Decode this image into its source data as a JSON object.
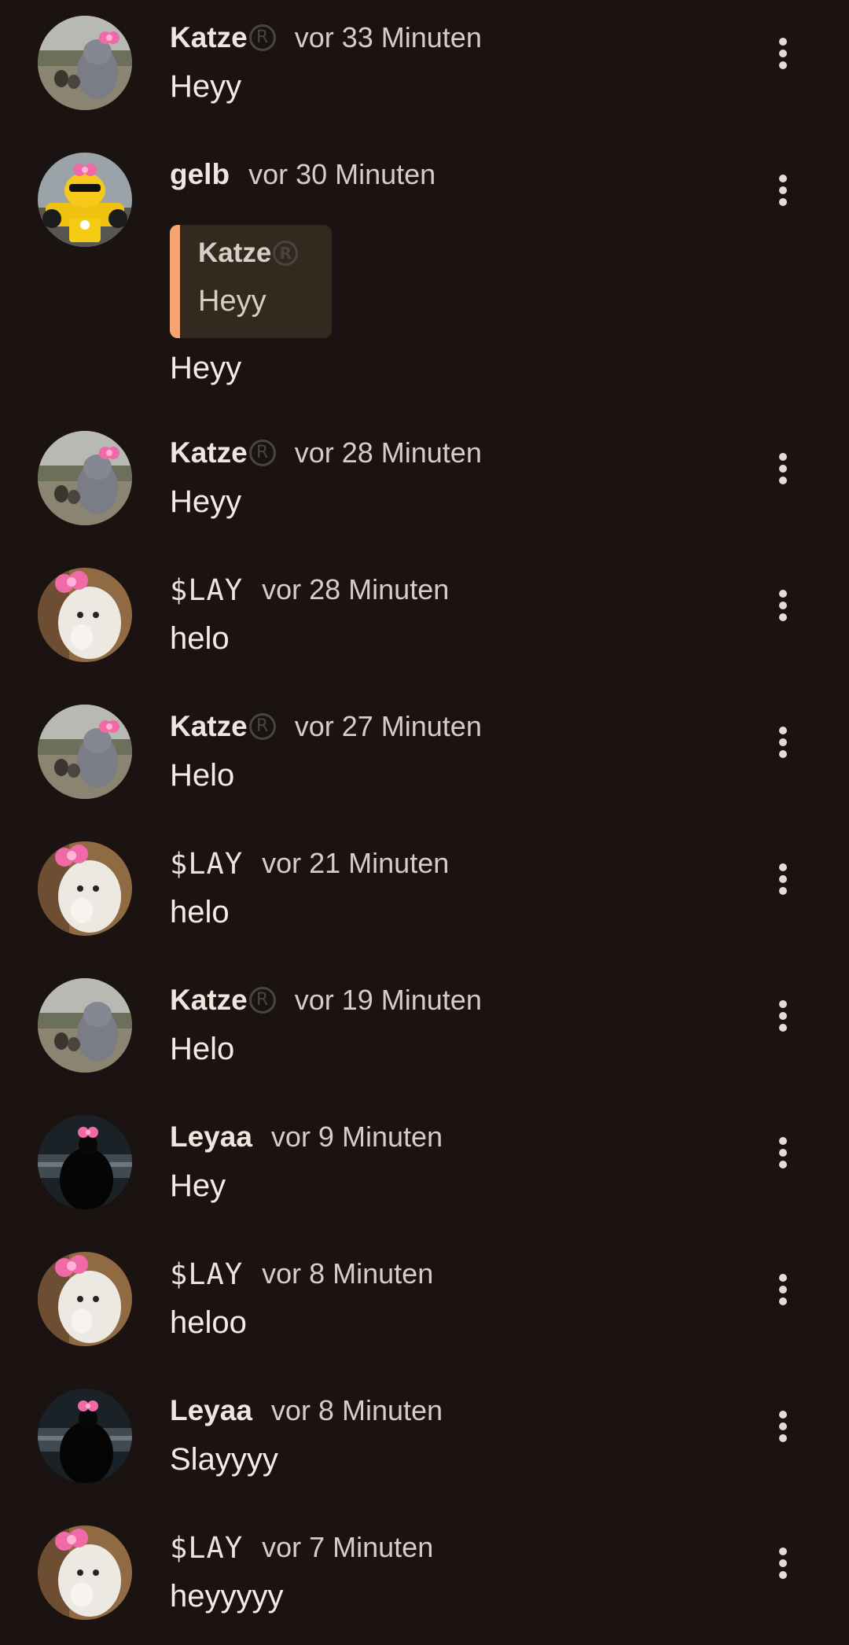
{
  "messages": [
    {
      "author": "Katze",
      "verified_glyph": "R",
      "time": "vor 33 Minuten",
      "text": "Heyy",
      "avatar": "cat-in-yard-avatar"
    },
    {
      "author": "gelb",
      "time": "vor 30 Minuten",
      "text": "Heyy",
      "avatar": "yellow-racecar-avatar",
      "reply_to": {
        "author": "Katze",
        "verified_glyph": "R",
        "text": "Heyy"
      }
    },
    {
      "author": "Katze",
      "verified_glyph": "R",
      "time": "vor 28 Minuten",
      "text": "Heyy",
      "avatar": "cat-in-yard-avatar"
    },
    {
      "author": "$LAY",
      "time": "vor 28 Minuten",
      "text": "helo",
      "avatar": "white-cat-bow-avatar"
    },
    {
      "author": "Katze",
      "verified_glyph": "R",
      "time": "vor 27 Minuten",
      "text": "Helo",
      "avatar": "cat-in-yard-avatar"
    },
    {
      "author": "$LAY",
      "time": "vor 21 Minuten",
      "text": "helo",
      "avatar": "white-cat-bow-avatar"
    },
    {
      "author": "Katze",
      "verified_glyph": "R",
      "time": "vor 19 Minuten",
      "text": "Helo",
      "avatar": "cat-in-yard-avatar"
    },
    {
      "author": "Leyaa",
      "time": "vor 9 Minuten",
      "text": "Hey",
      "avatar": "dark-silhouette-avatar"
    },
    {
      "author": "$LAY",
      "time": "vor 8 Minuten",
      "text": "heloo",
      "avatar": "white-cat-bow-avatar"
    },
    {
      "author": "Leyaa",
      "time": "vor 8 Minuten",
      "text": "Slayyyy",
      "avatar": "dark-silhouette-avatar"
    },
    {
      "author": "$LAY",
      "time": "vor 7 Minuten",
      "text": "heyyyyy",
      "avatar": "white-cat-bow-avatar"
    }
  ],
  "icons": {
    "more_options": "vertical-ellipsis-icon",
    "verified_badge": "registered-badge-icon"
  },
  "colors": {
    "background": "#1a1311",
    "reply_accent": "#f4a573",
    "reply_background": "#33291f",
    "bow_pink": "#f06aa8"
  }
}
